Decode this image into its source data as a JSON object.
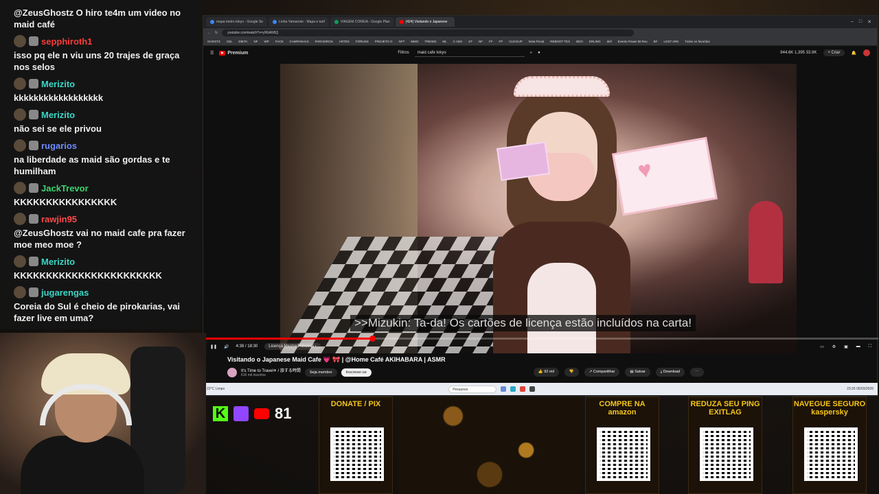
{
  "chat": {
    "messages": [
      {
        "user": "",
        "text": "@ZeusGhostz O hiro te4m um video no maid café",
        "color": "#ffffff"
      },
      {
        "user": "sepphiroth1",
        "text": "isso pq ele n viu uns 20 trajes de graça nos selos",
        "color": "#ff3b3b"
      },
      {
        "user": "Merizito",
        "text": "kkkkkkkkkkkkkkkkkk",
        "color": "#3bd6c6"
      },
      {
        "user": "Merizito",
        "text": "não sei se ele privou",
        "color": "#3bd6c6"
      },
      {
        "user": "rugarios",
        "text": "na liberdade as maid são gordas e te humilham",
        "color": "#6f8dff"
      },
      {
        "user": "JackTrevor",
        "text": "KKKKKKKKKKKKKKKK",
        "color": "#3bd66f"
      },
      {
        "user": "rawjin95",
        "text": "@ZeusGhostz vai no maid cafe pra fazer moe meo moe ?",
        "color": "#ff4a4a"
      },
      {
        "user": "Merizito",
        "text": "KKKKKKKKKKKKKKKKKKKKKKK",
        "color": "#3bd6c6"
      },
      {
        "user": "jugarengas",
        "text": "Coreia do Sul é cheio de pirokarias, vai fazer live em uma?",
        "color": "#3bd6c6"
      }
    ]
  },
  "browser": {
    "tabs": [
      {
        "label": "mapa metro tokyo - Google Se"
      },
      {
        "label": "Linha Yamanote - Mapa e tarif"
      },
      {
        "label": "VIAGEM COREIA - Google Plan"
      },
      {
        "label": "(424) Visitando o Japanese"
      }
    ],
    "url": "youtube.com/watch?v=y9GAN5Q",
    "bookmarks": [
      "GHOSTZ",
      "CEL",
      "DIETA",
      "NF",
      "WP",
      "FACE",
      "CAMPANHAS",
      "PARCEIROS",
      "ARTES",
      "FÓRUNS",
      "PROJETO G",
      "NFT",
      "MMO",
      "TREINO",
      "ML",
      "C ADS",
      "ST",
      "NF",
      "FF",
      "FP",
      "CLICKUP",
      "Nota Fiscal",
      "REBOOT TEX",
      "BDO",
      "ERLING",
      "dell",
      "Evento Power BI Reu",
      "BF",
      "LOST ARK",
      "Todos os favoritos"
    ]
  },
  "youtube": {
    "logo": "Premium",
    "filters": "Filtros",
    "search_value": "maid cafe tokyo",
    "create_label": "Criar",
    "stats": "944.6K  1,395  33.9K"
  },
  "player": {
    "subtitle": ">>Mizukin: Ta-da! Os cartões de licença estão incluídos na carta!",
    "time": "4:38 / 18:30",
    "chapter": "Licença Mestre/Princesa",
    "progress": 0.25
  },
  "video": {
    "title": "Visitando o Japanese Maid Cafe 💗 🎀 | @Home Café AKIHABARA | ASMR",
    "channel": "It's Time to Travel✈ / 旅する時間",
    "subscribers": "616 mil inscritos",
    "join_label": "Seja membro",
    "subscribe_label": "Inscrever-se",
    "likes": "92 mil",
    "share_label": "Compartilhar",
    "save_label": "Salvar",
    "download_label": "Download"
  },
  "taskbar": {
    "weather": "22°C Limpo",
    "search_placeholder": "Pesquisar",
    "clock": "23:29 05/03/2026"
  },
  "overlay": {
    "sub_count": "81",
    "cards": [
      {
        "title": "DONATE / PIX"
      },
      {
        "title": "COMPRE NA amazon"
      },
      {
        "title": "REDUZA SEU PING EXITLAG"
      },
      {
        "title": "NAVEGUE SEGURO kaspersky"
      }
    ]
  }
}
